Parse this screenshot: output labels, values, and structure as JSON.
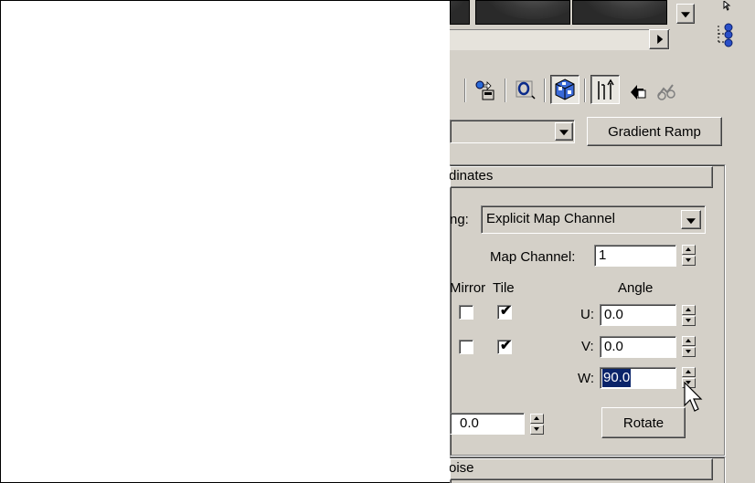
{
  "toolbar": {
    "map_type_button_label": "Gradient Ramp"
  },
  "coordinates": {
    "rollout_title": "dinates",
    "mapping_label": "ng:",
    "mapping_value": "Explicit Map Channel",
    "map_channel_label": "Map Channel:",
    "map_channel_value": "1",
    "mirror_label": "Mirror",
    "tile_label": "Tile",
    "angle_label": "Angle",
    "u_label": "U:",
    "v_label": "V:",
    "w_label": "W:",
    "u_angle": "0.0",
    "v_angle": "0.0",
    "w_angle": "90.0",
    "mirror_u_checked": false,
    "tile_u_checked": true,
    "mirror_v_checked": false,
    "tile_v_checked": true,
    "blur_value": "0.0",
    "rotate_label": "Rotate",
    "check_mark": "✔"
  },
  "noise": {
    "rollout_title": "oise"
  },
  "colors": {
    "panel_bg": "#d4d0c8",
    "selection": "#0a246a"
  }
}
